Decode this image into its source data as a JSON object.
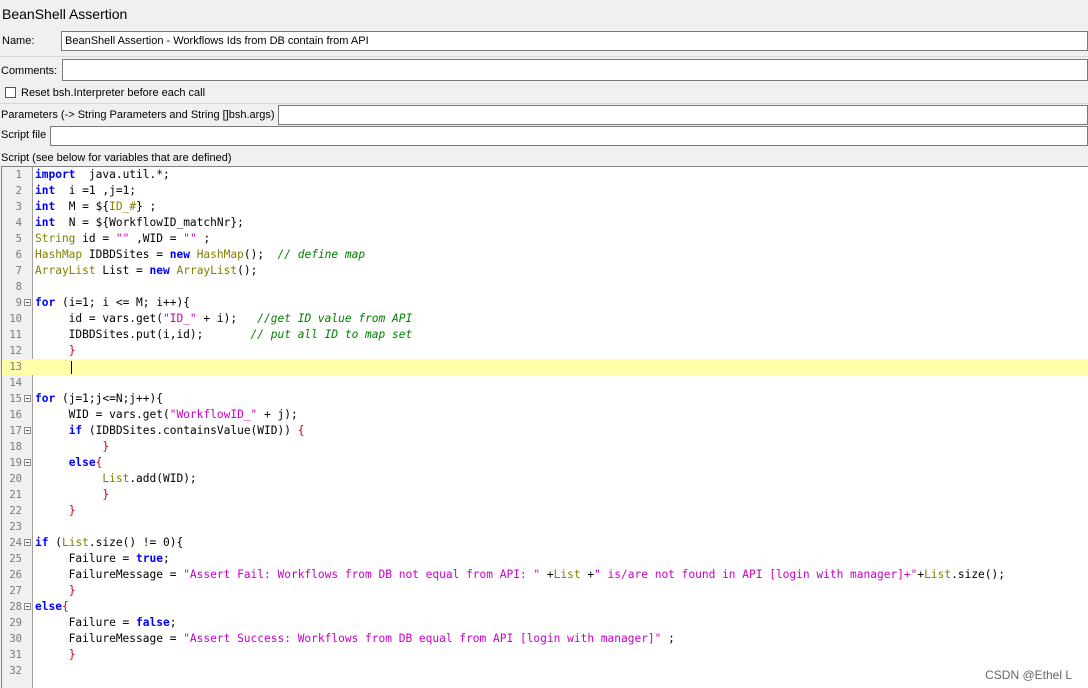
{
  "panel": {
    "title": "BeanShell Assertion",
    "name_label": "Name:",
    "name_value": "BeanShell Assertion - Workflows Ids from DB contain from API",
    "comments_label": "Comments:",
    "comments_value": "",
    "reset_label": "Reset bsh.Interpreter before each call",
    "reset_checked": false,
    "parameters_label": "Parameters (-> String Parameters and String []bsh.args)",
    "parameters_value": "",
    "script_file_label": "Script file",
    "script_file_value": "",
    "script_label": "Script (see below for variables that are defined)"
  },
  "editor": {
    "current_line": 13,
    "lines": [
      {
        "n": "1",
        "fold": false,
        "segs": [
          [
            "kw",
            "import"
          ],
          [
            "",
            "  java.util.*;"
          ]
        ]
      },
      {
        "n": "2",
        "fold": false,
        "segs": [
          [
            "kw",
            "int"
          ],
          [
            "",
            "  i =1 ,j=1;"
          ]
        ]
      },
      {
        "n": "3",
        "fold": false,
        "segs": [
          [
            "kw",
            "int"
          ],
          [
            "",
            "  M = ${"
          ],
          [
            "ty",
            "ID_#"
          ],
          [
            "",
            "} ;"
          ]
        ]
      },
      {
        "n": "4",
        "fold": false,
        "segs": [
          [
            "kw",
            "int"
          ],
          [
            "",
            "  N = ${WorkflowID_matchNr};"
          ]
        ]
      },
      {
        "n": "5",
        "fold": false,
        "segs": [
          [
            "ty",
            "String"
          ],
          [
            "",
            " id = "
          ],
          [
            "st",
            "\"\""
          ],
          [
            "",
            " ,WID = "
          ],
          [
            "st",
            "\"\""
          ],
          [
            "",
            " ;"
          ]
        ]
      },
      {
        "n": "6",
        "fold": false,
        "segs": [
          [
            "ty",
            "HashMap"
          ],
          [
            "",
            " IDBDSites = "
          ],
          [
            "kw",
            "new"
          ],
          [
            "",
            " "
          ],
          [
            "ty",
            "HashMap"
          ],
          [
            "",
            "();  "
          ],
          [
            "cm",
            "// define map"
          ]
        ]
      },
      {
        "n": "7",
        "fold": false,
        "segs": [
          [
            "ty",
            "ArrayList"
          ],
          [
            "",
            " List = "
          ],
          [
            "kw",
            "new"
          ],
          [
            "",
            " "
          ],
          [
            "ty",
            "ArrayList"
          ],
          [
            "",
            "();"
          ]
        ]
      },
      {
        "n": "8",
        "fold": false,
        "segs": []
      },
      {
        "n": "9",
        "fold": true,
        "segs": [
          [
            "kw",
            "for"
          ],
          [
            "",
            " (i=1; i <= M; i++){"
          ]
        ]
      },
      {
        "n": "10",
        "fold": false,
        "segs": [
          [
            "",
            "     id = vars.get("
          ],
          [
            "st",
            "\"ID_\""
          ],
          [
            "",
            " + i);   "
          ],
          [
            "cm",
            "//get ID value from API"
          ]
        ]
      },
      {
        "n": "11",
        "fold": false,
        "segs": [
          [
            "",
            "     IDBDSites.put(i,id);       "
          ],
          [
            "cm",
            "// put all ID to map set"
          ]
        ]
      },
      {
        "n": "12",
        "fold": false,
        "segs": [
          [
            "",
            "     "
          ],
          [
            "br",
            "}"
          ]
        ]
      },
      {
        "n": "13",
        "fold": false,
        "segs": []
      },
      {
        "n": "14",
        "fold": false,
        "segs": []
      },
      {
        "n": "15",
        "fold": true,
        "segs": [
          [
            "kw",
            "for"
          ],
          [
            "",
            " (j=1;j<=N;j++){"
          ]
        ]
      },
      {
        "n": "16",
        "fold": false,
        "segs": [
          [
            "",
            "     WID = vars.get("
          ],
          [
            "st",
            "\"WorkflowID_\""
          ],
          [
            "",
            " + j);"
          ]
        ]
      },
      {
        "n": "17",
        "fold": true,
        "segs": [
          [
            "",
            "     "
          ],
          [
            "kw",
            "if"
          ],
          [
            "",
            " (IDBDSites.containsValue(WID)) "
          ],
          [
            "br",
            "{"
          ]
        ]
      },
      {
        "n": "18",
        "fold": false,
        "segs": [
          [
            "",
            "          "
          ],
          [
            "br",
            "}"
          ]
        ]
      },
      {
        "n": "19",
        "fold": true,
        "segs": [
          [
            "",
            "     "
          ],
          [
            "kw",
            "else"
          ],
          [
            "br",
            "{"
          ]
        ]
      },
      {
        "n": "20",
        "fold": false,
        "segs": [
          [
            "",
            "          "
          ],
          [
            "ty",
            "List"
          ],
          [
            "",
            ".add(WID);"
          ]
        ]
      },
      {
        "n": "21",
        "fold": false,
        "segs": [
          [
            "",
            "          "
          ],
          [
            "br",
            "}"
          ]
        ]
      },
      {
        "n": "22",
        "fold": false,
        "segs": [
          [
            "",
            "     "
          ],
          [
            "br",
            "}"
          ]
        ]
      },
      {
        "n": "23",
        "fold": false,
        "segs": []
      },
      {
        "n": "24",
        "fold": true,
        "segs": [
          [
            "kw",
            "if"
          ],
          [
            "",
            " ("
          ],
          [
            "ty",
            "List"
          ],
          [
            "",
            ".size() != 0){"
          ]
        ]
      },
      {
        "n": "25",
        "fold": false,
        "segs": [
          [
            "",
            "     Failure = "
          ],
          [
            "kw",
            "true"
          ],
          [
            "",
            ";"
          ]
        ]
      },
      {
        "n": "26",
        "fold": false,
        "segs": [
          [
            "",
            "     FailureMessage = "
          ],
          [
            "st",
            "\"Assert Fail: Workflows from DB not equal from API: \""
          ],
          [
            "",
            " +"
          ],
          [
            "ty",
            "List"
          ],
          [
            "",
            " +"
          ],
          [
            "st",
            "\" is/are not found in API [login with manager]+\""
          ],
          [
            "",
            "+"
          ],
          [
            "ty",
            "List"
          ],
          [
            "",
            ".size();"
          ]
        ]
      },
      {
        "n": "27",
        "fold": false,
        "segs": [
          [
            "",
            "     "
          ],
          [
            "br",
            "}"
          ]
        ]
      },
      {
        "n": "28",
        "fold": true,
        "segs": [
          [
            "kw",
            "else"
          ],
          [
            "br",
            "{"
          ]
        ]
      },
      {
        "n": "29",
        "fold": false,
        "segs": [
          [
            "",
            "     Failure = "
          ],
          [
            "kw",
            "false"
          ],
          [
            "",
            ";"
          ]
        ]
      },
      {
        "n": "30",
        "fold": false,
        "segs": [
          [
            "",
            "     FailureMessage = "
          ],
          [
            "st",
            "\"Assert Success: Workflows from DB equal from API [login with manager]\""
          ],
          [
            "",
            " ;"
          ]
        ]
      },
      {
        "n": "31",
        "fold": false,
        "segs": [
          [
            "",
            "     "
          ],
          [
            "br",
            "}"
          ]
        ]
      },
      {
        "n": "32",
        "fold": false,
        "segs": []
      }
    ]
  },
  "watermark": "CSDN @Ethel L"
}
